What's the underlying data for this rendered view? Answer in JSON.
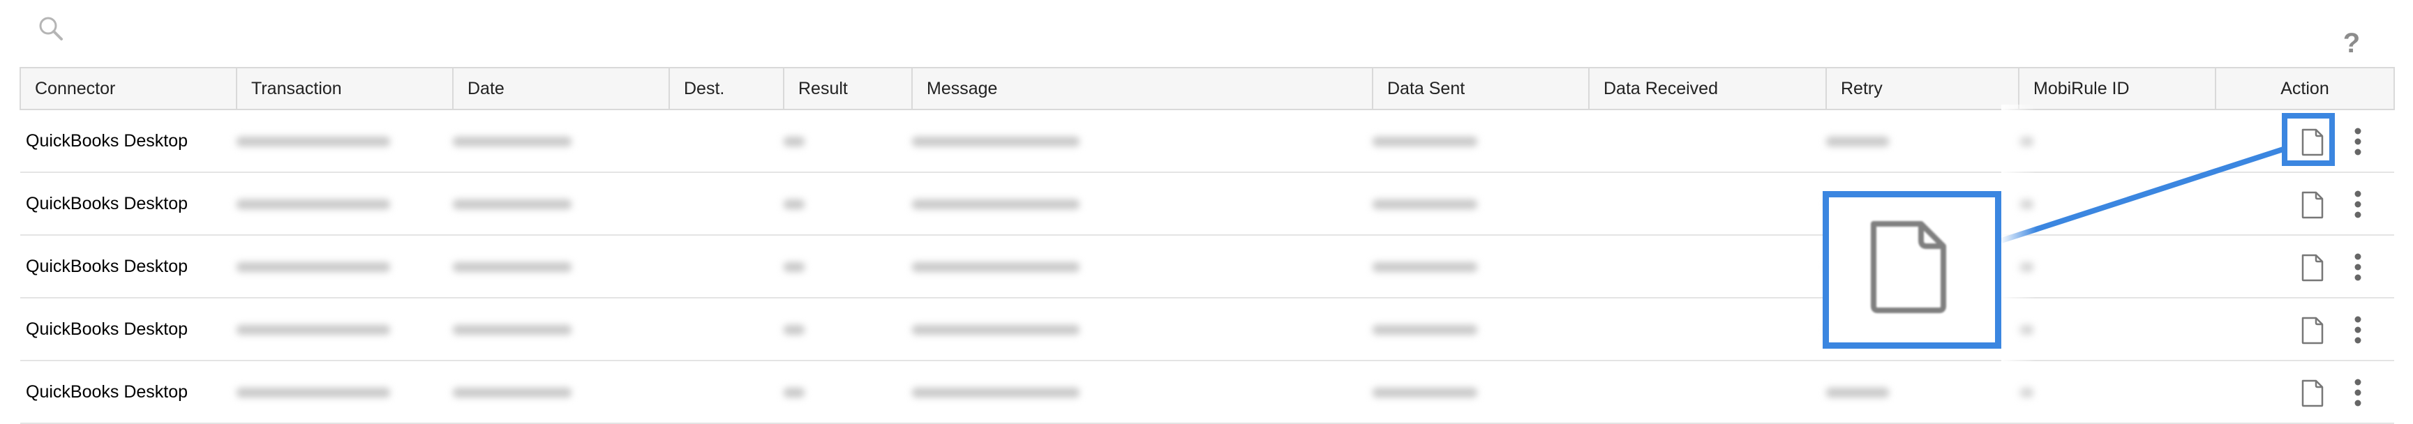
{
  "toolbar": {
    "search_icon": "search-icon",
    "help_label": "?"
  },
  "table": {
    "columns": [
      "Connector",
      "Transaction",
      "Date",
      "Dest.",
      "Result",
      "Message",
      "Data Sent",
      "Data Received",
      "Retry",
      "MobiRule ID",
      "Action"
    ],
    "rows": [
      {
        "connector": "QuickBooks Desktop"
      },
      {
        "connector": "QuickBooks Desktop"
      },
      {
        "connector": "QuickBooks Desktop"
      },
      {
        "connector": "QuickBooks Desktop"
      },
      {
        "connector": "QuickBooks Desktop"
      }
    ]
  },
  "icons": {
    "view": "document-icon",
    "more": "more-vertical-icon"
  },
  "colors": {
    "highlight": "#3b86e0",
    "header_bg": "#f6f6f6",
    "icon_gray": "#8c8c8c"
  }
}
